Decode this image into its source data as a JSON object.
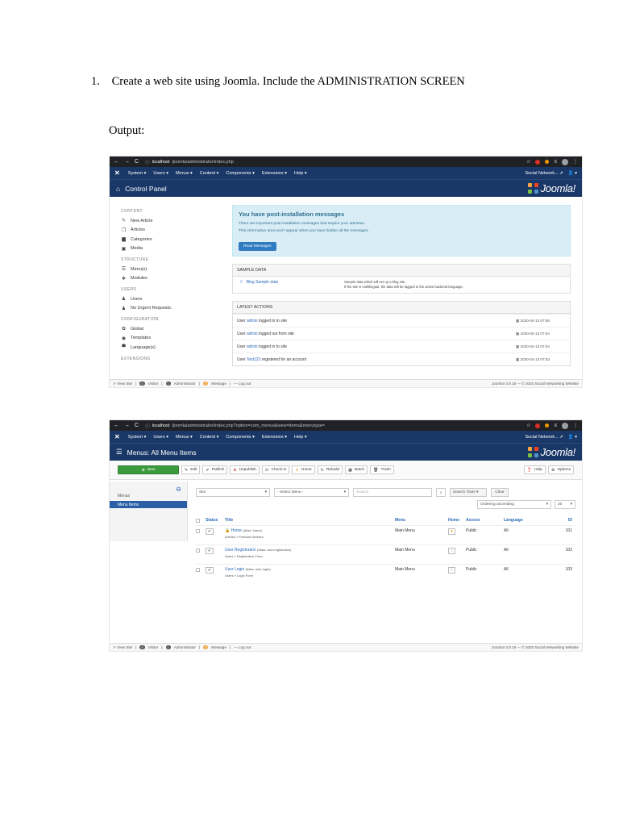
{
  "question": {
    "number": "1.",
    "text": "Create a web site using Joomla. Include the ADMINISTRATION SCREEN"
  },
  "output_label": "Output:",
  "shot1": {
    "url_host": "localhost",
    "url_path": "/joomla/administrator/index.php",
    "menubar": [
      "System ▾",
      "Users ▾",
      "Menus ▾",
      "Content ▾",
      "Components ▾",
      "Extensions ▾",
      "Help ▾"
    ],
    "menubar_right": "Social Network... ⇗",
    "user_menu": "👤 ▾",
    "header_title": "Control Panel",
    "logo_text": "Joomla!",
    "sidebar": [
      {
        "section": "CONTENT",
        "items": [
          {
            "icon": "✎",
            "label": "New Article"
          },
          {
            "icon": "❐",
            "label": "Articles"
          },
          {
            "icon": "▆",
            "label": "Categories"
          },
          {
            "icon": "▣",
            "label": "Media"
          }
        ]
      },
      {
        "section": "STRUCTURE",
        "items": [
          {
            "icon": "☰",
            "label": "Menu(s)"
          },
          {
            "icon": "❖",
            "label": "Modules"
          }
        ]
      },
      {
        "section": "USERS",
        "items": [
          {
            "icon": "♟",
            "label": "Users"
          },
          {
            "icon": "♟",
            "label": "No Urgent Requests."
          }
        ]
      },
      {
        "section": "CONFIGURATION",
        "items": [
          {
            "icon": "✿",
            "label": "Global"
          },
          {
            "icon": "◉",
            "label": "Templates"
          },
          {
            "icon": "▀",
            "label": "Language(s)"
          }
        ]
      },
      {
        "section": "EXTENSIONS",
        "items": []
      }
    ],
    "message": {
      "title": "You have post-installation messages",
      "line1": "There are important post-installation messages that require your attention.",
      "line2": "This information area won't appear when you have hidden all the messages.",
      "button": "Read Messages"
    },
    "sample_data": {
      "heading": "SAMPLE DATA",
      "name": "Blog Sample data",
      "desc1": "Sample data which will set up a blog site.",
      "desc2": "If the site is multilingual, the data will be tagged to the active backend language."
    },
    "latest_actions": {
      "heading": "LATEST ACTIONS",
      "rows": [
        {
          "pre": "User ",
          "link": "admin",
          "post": " logged in to site",
          "date": "2020-04-13 07:55"
        },
        {
          "pre": "User ",
          "link": "admin",
          "post": " logged out from site",
          "date": "2020-04-13 07:54"
        },
        {
          "pre": "User ",
          "link": "admin",
          "post": " logged in to site",
          "date": "2020-04-13 07:54"
        },
        {
          "pre": "User ",
          "link": "Test123",
          "post": " registered for an account",
          "date": "2020-04-13 07:53"
        }
      ]
    },
    "status": {
      "view_site": "⇗ View Site",
      "visitor_count": "0",
      "visitor": "Visitor",
      "admin_count": "1",
      "admin": "Administrator",
      "message_count": "1",
      "message": "Message",
      "logout": "— Log out",
      "footer": "Joomla! 3.9.16 — © 2020 Social Networking Website"
    }
  },
  "shot2": {
    "url_host": "localhost",
    "url_path": "/joomla/administrator/index.php?option=com_menus&view=items&menutype=",
    "menubar": [
      "System ▾",
      "Users ▾",
      "Menus ▾",
      "Content ▾",
      "Components ▾",
      "Extensions ▾",
      "Help ▾"
    ],
    "menubar_right": "Social Network... ⇗",
    "user_menu": "👤 ▾",
    "header_title": "Menus: All Menu Items",
    "logo_text": "Joomla!",
    "toolbar": [
      {
        "icon": "⊕",
        "label": "New"
      },
      {
        "icon": "✎",
        "label": "Edit"
      },
      {
        "icon": "✔",
        "label": "Publish"
      },
      {
        "icon": "⊗",
        "label": "Unpublish"
      },
      {
        "icon": "☑",
        "label": "Check-in"
      },
      {
        "icon": "★",
        "label": "Home"
      },
      {
        "icon": "↻",
        "label": "Rebuild"
      },
      {
        "icon": "▦",
        "label": "Batch"
      },
      {
        "icon": "🗑",
        "label": "Trash"
      }
    ],
    "toolbar_right": [
      {
        "icon": "❓",
        "label": "Help"
      },
      {
        "icon": "⚙",
        "label": "Options"
      }
    ],
    "sidebar_label": "Menus",
    "sidebar_active": "Menu Items",
    "filter_site": "Site",
    "filter_menu": "- Select Menu -",
    "search_placeholder": "Search",
    "search_tools": "Search Tools ▾",
    "clear": "Clear",
    "ordering": "Ordering ascending",
    "limit": "20",
    "columns": [
      "Status",
      "Title",
      "Menu",
      "Home",
      "Access",
      "Language",
      "ID"
    ],
    "rows": [
      {
        "title": "Home",
        "alias": "(Alias: home)",
        "type": "Articles » Featured Articles",
        "menu": "Main Menu",
        "home_icon": "★",
        "access": "Public",
        "language": "All",
        "id": "101",
        "locked": "🔒"
      },
      {
        "title": "User Registration",
        "alias": "(Alias: user-registration)",
        "type": "Users » Registration Form",
        "menu": "Main Menu",
        "home_icon": "☆",
        "access": "Public",
        "language": "All",
        "id": "102",
        "locked": ""
      },
      {
        "title": "User Login",
        "alias": "(Alias: user-login)",
        "type": "Users » Login Form",
        "menu": "Main Menu",
        "home_icon": "☆",
        "access": "Public",
        "language": "All",
        "id": "103",
        "locked": ""
      }
    ],
    "status": {
      "view_site": "⇗ View Site",
      "visitor_count": "0",
      "visitor": "Visitor",
      "admin_count": "1",
      "admin": "Administrator",
      "message_count": "1",
      "message": "Message",
      "logout": "— Log out",
      "footer": "Joomla! 3.9.16 — © 2020 Social Networking Website"
    }
  }
}
